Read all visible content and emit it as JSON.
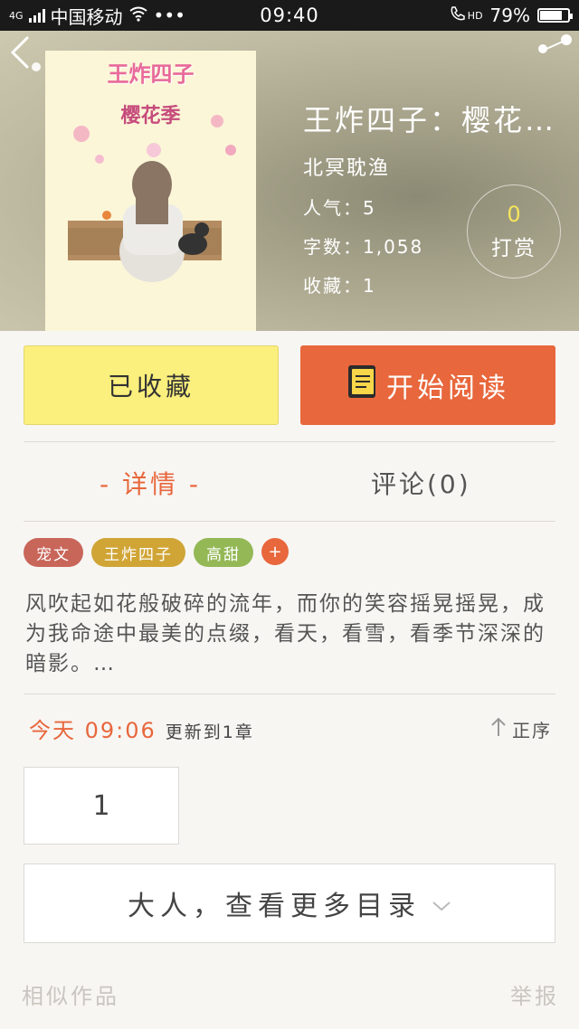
{
  "status_bar": {
    "network": "4G",
    "carrier": "中国移动",
    "extra": "•••",
    "time": "09:40",
    "hd": "HD",
    "battery": "79%",
    "battery_level": 0.79
  },
  "book": {
    "cover_title": "王炸四子",
    "cover_subtitle": "樱花季",
    "title": "王炸四子：樱花…",
    "author": "北冥耽渔",
    "popularity": "人气：5",
    "word_count": "字数：1,058",
    "favorites": "收藏：1"
  },
  "reward": {
    "count": "0",
    "label": "打赏"
  },
  "actions": {
    "collected": "已收藏",
    "read": "开始阅读"
  },
  "tabs": {
    "detail": "- 详情 -",
    "comments": "评论(0)"
  },
  "tags": [
    {
      "label": "宠文",
      "color": "#c9665a"
    },
    {
      "label": "王炸四子",
      "color": "#d0a536"
    },
    {
      "label": "高甜",
      "color": "#93b855"
    }
  ],
  "tag_add": "+",
  "synopsis": "风吹起如花般破碎的流年，而你的笑容摇晃摇晃，成为我命途中最美的点缀，看天，看雪，看季节深深的暗影。…",
  "update": {
    "time": "今天 09:06",
    "text": "更新到1章",
    "sort": "正序"
  },
  "chapter": "1",
  "more_toc": "大人，查看更多目录",
  "footer": {
    "similar": "相似作品",
    "report": "举报"
  },
  "colors": {
    "accent": "#e8673c",
    "collected_bg": "#fbef7d",
    "reward_count": "#f4e45c"
  }
}
